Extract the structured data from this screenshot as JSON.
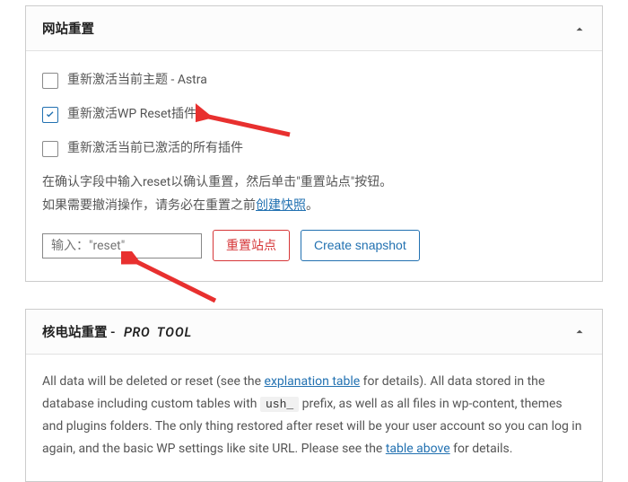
{
  "panel1": {
    "title": "网站重置",
    "options": [
      {
        "label": "重新激活当前主题 - Astra",
        "checked": false
      },
      {
        "label": "重新激活WP Reset插件",
        "checked": true
      },
      {
        "label": "重新激活当前已激活的所有插件",
        "checked": false
      }
    ],
    "desc_line1": "在确认字段中输入reset以确认重置，然后单击\"重置站点\"按钮。",
    "desc_line2_prefix": "如果需要撤消操作，请务必在重置之前",
    "desc_line2_link": "创建快照",
    "desc_line2_suffix": "。",
    "input_placeholder": "输入：\"reset\"",
    "btn_reset": "重置站点",
    "btn_snapshot": "Create snapshot"
  },
  "panel2": {
    "title": "核电站重置 -",
    "pro": "PRO",
    "tool": "TOOL",
    "text_1": "All data will be deleted or reset (see the ",
    "link_1": "explanation table",
    "text_2": " for details). All data stored in the database including custom tables with ",
    "code": "ush_",
    "text_3": " prefix, as well as all files in wp-content, themes and plugins folders. The only thing restored after reset will be your user account so you can log in again, and the basic WP settings like site URL. Please see the ",
    "link_2": "table above",
    "text_4": " for details."
  }
}
